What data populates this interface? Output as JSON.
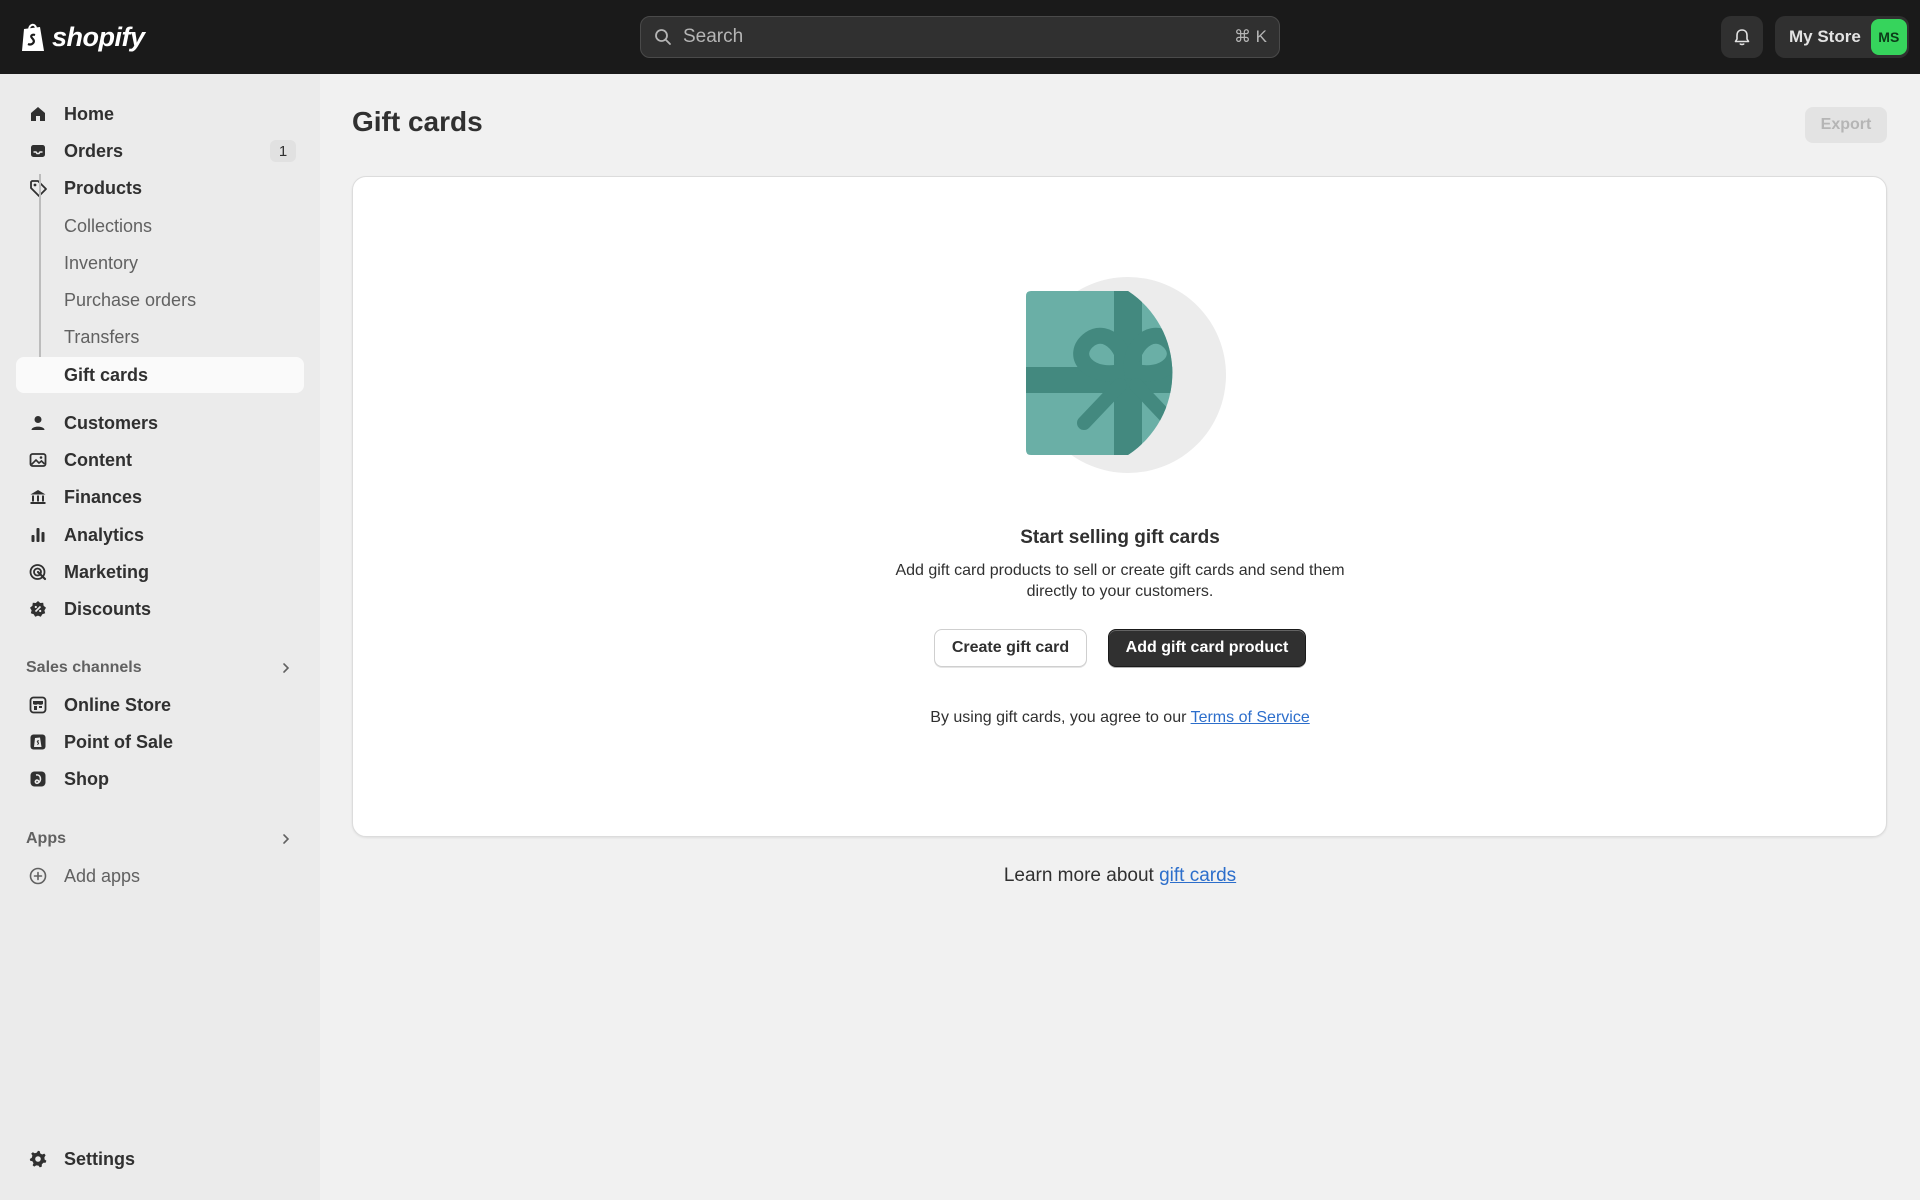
{
  "app": {
    "logo_text": "shopify",
    "search_placeholder": "Search",
    "search_shortcut": "⌘ K",
    "store_name": "My Store",
    "avatar_initials": "MS",
    "avatar_color": "#36d45c"
  },
  "sidebar": {
    "items": [
      {
        "label": "Home",
        "icon": "home-icon"
      },
      {
        "label": "Orders",
        "icon": "inbox-icon",
        "badge": "1"
      },
      {
        "label": "Products",
        "icon": "tag-icon"
      }
    ],
    "product_subitems": [
      {
        "label": "Collections"
      },
      {
        "label": "Inventory"
      },
      {
        "label": "Purchase orders"
      },
      {
        "label": "Transfers"
      },
      {
        "label": "Gift cards",
        "active": true
      }
    ],
    "items2": [
      {
        "label": "Customers",
        "icon": "person-icon"
      },
      {
        "label": "Content",
        "icon": "image-icon"
      },
      {
        "label": "Finances",
        "icon": "bank-icon"
      },
      {
        "label": "Analytics",
        "icon": "bar-chart-icon"
      },
      {
        "label": "Marketing",
        "icon": "target-icon"
      },
      {
        "label": "Discounts",
        "icon": "discount-icon"
      }
    ],
    "sales_channels_label": "Sales channels",
    "sales_channels": [
      {
        "label": "Online Store",
        "icon": "store-icon"
      },
      {
        "label": "Point of Sale",
        "icon": "pos-icon"
      },
      {
        "label": "Shop",
        "icon": "shop-icon"
      }
    ],
    "apps_label": "Apps",
    "add_apps_label": "Add apps",
    "settings_label": "Settings"
  },
  "main": {
    "title": "Gift cards",
    "export_label": "Export",
    "empty_state": {
      "heading": "Start selling gift cards",
      "description": "Add gift card products to sell or create gift cards and send them directly to your customers.",
      "secondary_button": "Create gift card",
      "primary_button": "Add gift card product",
      "terms_prefix": "By using gift cards, you agree to our ",
      "terms_link": "Terms of Service"
    },
    "learn_more_prefix": "Learn more about ",
    "learn_more_link": "gift cards"
  }
}
